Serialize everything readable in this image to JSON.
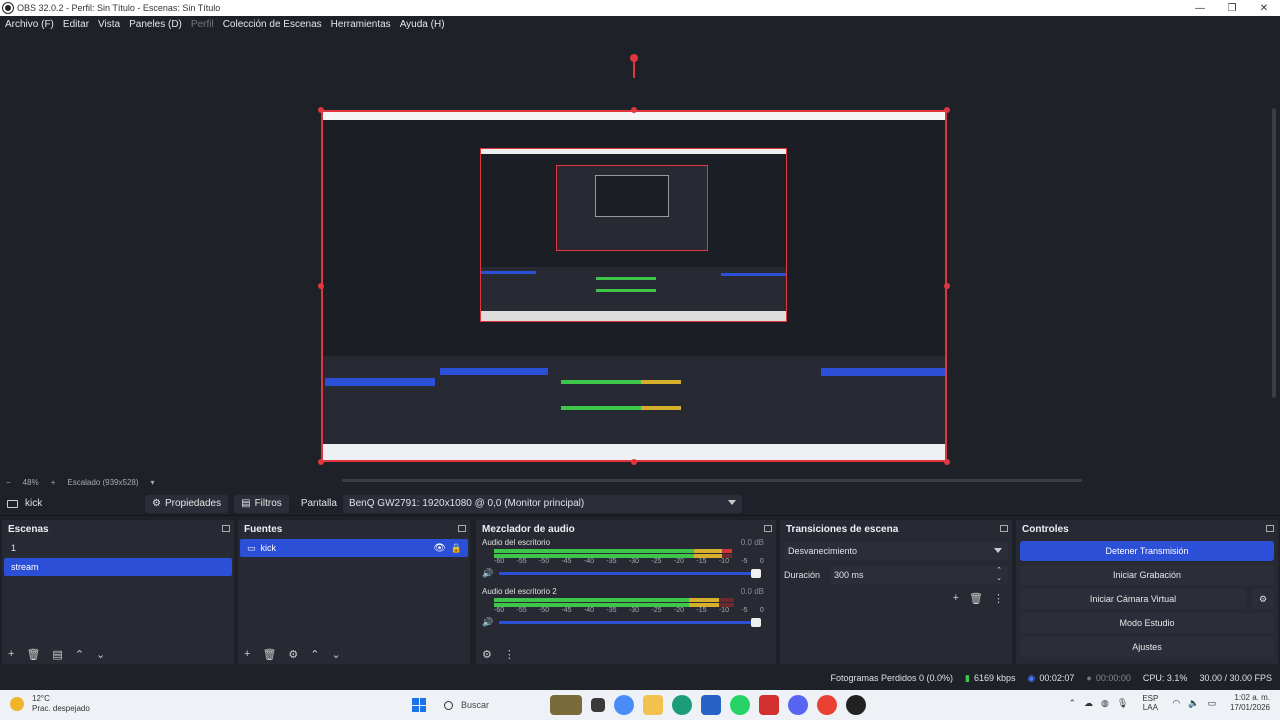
{
  "window": {
    "title": "OBS 32.0.2 - Perfil: Sin Título - Escenas: Sin Título",
    "minimize": "—",
    "maximize": "❐",
    "close": "✕"
  },
  "menu": [
    {
      "label": "Archivo (F)"
    },
    {
      "label": "Editar"
    },
    {
      "label": "Vista"
    },
    {
      "label": "Paneles (D)"
    },
    {
      "label": "Perfil"
    },
    {
      "label": "Colección de Escenas"
    },
    {
      "label": "Herramientas"
    },
    {
      "label": "Ayuda (H)"
    }
  ],
  "zoom": {
    "minus": "−",
    "level": "48%",
    "plus": "+",
    "scaling": "Escalado (939x528)",
    "arrow": "▾"
  },
  "context": {
    "source_name": "kick",
    "properties_label": "Propiedades",
    "filters_label": "Filtros",
    "screen_label": "Pantalla",
    "display_value": "BenQ GW2791: 1920x1080 @ 0,0 (Monitor principal)"
  },
  "scenes": {
    "title": "Escenas",
    "items": [
      {
        "label": "1",
        "selected": false
      },
      {
        "label": "stream",
        "selected": true
      }
    ]
  },
  "sources": {
    "title": "Fuentes",
    "items": [
      {
        "label": "kick",
        "selected": true
      }
    ]
  },
  "mixer": {
    "title": "Mezclador de audio",
    "channels": [
      {
        "name": "Audio del escritorio",
        "db": "0.0 dB",
        "level": 0.95
      },
      {
        "name": "Audio del escritorio 2",
        "db": "0.0 dB",
        "level": 0.93
      }
    ],
    "scale": [
      "-60",
      "-55",
      "-50",
      "-45",
      "-40",
      "-35",
      "-30",
      "-25",
      "-20",
      "-15",
      "-10",
      "-5",
      "0"
    ]
  },
  "transitions": {
    "title": "Transiciones de escena",
    "selected": "Desvanecimiento",
    "duration_label": "Duración",
    "duration_value": "300 ms"
  },
  "controls": {
    "title": "Controles",
    "stop_stream": "Detener Transmisión",
    "start_recording": "Iniciar Grabación",
    "start_virtual_cam": "Iniciar Cámara Virtual",
    "studio_mode": "Modo Estudio",
    "settings": "Ajustes"
  },
  "status": {
    "dropped": "Fotogramas Perdidos 0 (0.0%)",
    "bitrate": "6169 kbps",
    "stream_time": "00:02:07",
    "rec_time": "00:00:00",
    "cpu": "CPU: 3.1%",
    "fps": "30.00 / 30.00 FPS"
  },
  "taskbar": {
    "temp": "12°C",
    "weather": "Prac. despejado",
    "search": "Buscar",
    "lang_top": "ESP",
    "lang_bottom": "LAA",
    "time": "1:02 a. m.",
    "date": "17/01/2026"
  },
  "colors": {
    "accent": "#2c4fd8",
    "selection_red": "#e0363d",
    "meter_green": "#3ec64a",
    "meter_yellow": "#d6b02c",
    "meter_red": "#d0343a"
  }
}
